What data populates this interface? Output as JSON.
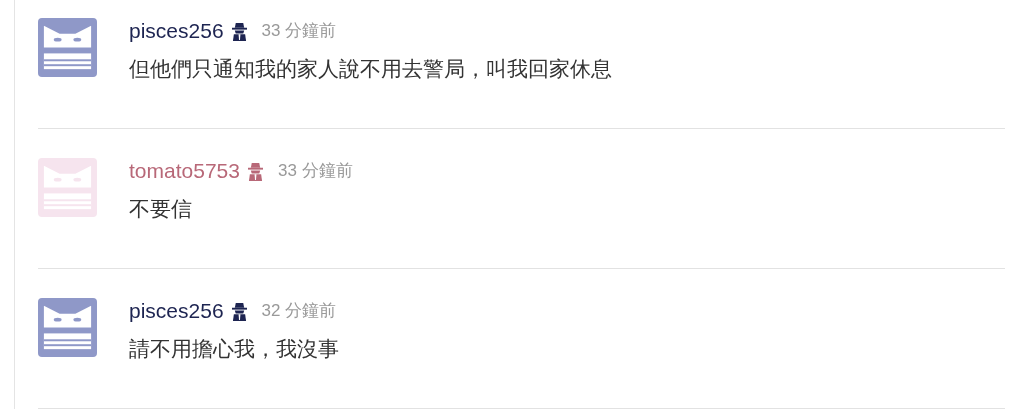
{
  "comments": [
    {
      "avatar": {
        "color": "#8f98c8"
      },
      "username": "pisces256",
      "color": "#1d2451",
      "time": "33 分鐘前",
      "text": "但他們只通知我的家人說不用去警局，叫我回家休息"
    },
    {
      "avatar": {
        "color": "#f6e4ee"
      },
      "username": "tomato5753",
      "color": "#b86878",
      "time": "33 分鐘前",
      "text": "不要信"
    },
    {
      "avatar": {
        "color": "#8f98c8"
      },
      "username": "pisces256",
      "color": "#1d2451",
      "time": "32 分鐘前",
      "text": "請不用擔心我，我沒事"
    }
  ]
}
